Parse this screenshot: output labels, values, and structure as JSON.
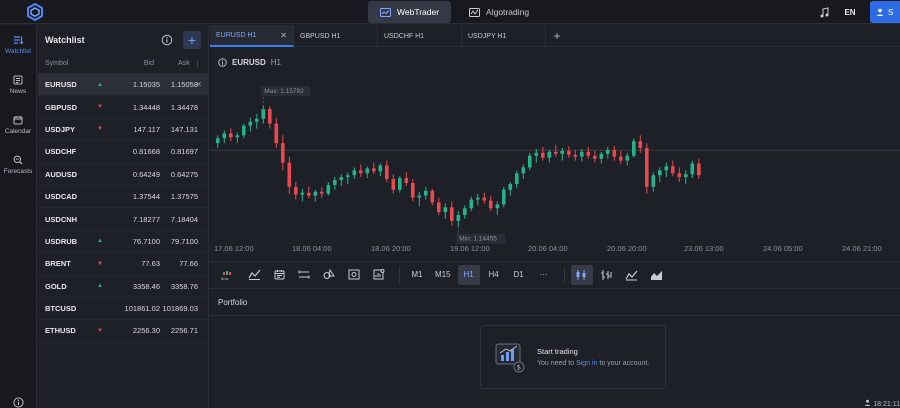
{
  "topbar": {
    "tabs": [
      {
        "label": "WebTrader",
        "active": true
      },
      {
        "label": "Algotrading",
        "active": false
      }
    ],
    "lang": "EN",
    "user_initial": "S"
  },
  "rail": [
    {
      "label": "Watchlist",
      "icon": "list-icon",
      "active": true
    },
    {
      "label": "News",
      "icon": "news-icon",
      "active": false
    },
    {
      "label": "Calendar",
      "icon": "calendar-icon",
      "active": false
    },
    {
      "label": "Forecasts",
      "icon": "forecast-icon",
      "active": false
    }
  ],
  "watchlist": {
    "title": "Watchlist",
    "columns": {
      "symbol": "Symbol",
      "bid": "Bid",
      "ask": "Ask"
    },
    "rows": [
      {
        "symbol": "EURUSD",
        "dir": "up",
        "bid": "1.15035",
        "ask": "1.15058",
        "selected": true
      },
      {
        "symbol": "GBPUSD",
        "dir": "down",
        "bid": "1.34448",
        "ask": "1.34478"
      },
      {
        "symbol": "USDJPY",
        "dir": "down",
        "bid": "147.117",
        "ask": "147.131"
      },
      {
        "symbol": "USDCHF",
        "dir": "",
        "bid": "0.81668",
        "ask": "0.81697"
      },
      {
        "symbol": "AUDUSD",
        "dir": "",
        "bid": "0.64249",
        "ask": "0.64275"
      },
      {
        "symbol": "USDCAD",
        "dir": "",
        "bid": "1.37544",
        "ask": "1.37575"
      },
      {
        "symbol": "USDCNH",
        "dir": "",
        "bid": "7.18277",
        "ask": "7.18404"
      },
      {
        "symbol": "USDRUB",
        "dir": "up",
        "bid": "76.7100",
        "ask": "79.7100"
      },
      {
        "symbol": "BRENT",
        "dir": "down",
        "bid": "77.63",
        "ask": "77.66"
      },
      {
        "symbol": "GOLD",
        "dir": "up",
        "bid": "3358.46",
        "ask": "3358.76"
      },
      {
        "symbol": "BTCUSD",
        "dir": "",
        "bid": "101861.02",
        "ask": "101869.03"
      },
      {
        "symbol": "ETHUSD",
        "dir": "down",
        "bid": "2256.30",
        "ask": "2256.71"
      }
    ]
  },
  "chart_tabs": [
    {
      "label": "EURUSD H1",
      "active": true
    },
    {
      "label": "GBPUSD H1",
      "active": false
    },
    {
      "label": "USDCHF H1",
      "active": false
    },
    {
      "label": "USDJPY H1",
      "active": false
    }
  ],
  "chart_header": {
    "symbol": "EURUSD",
    "timeframe": "H1"
  },
  "chart_labels": {
    "max": "Max: 1.15792",
    "min": "Min: 1.14455"
  },
  "xaxis": [
    "17.06 12:00",
    "18.06 04:00",
    "18.06 20:00",
    "19.06 12:00",
    "20.06 04:00",
    "20.06 20:00",
    "23.06 13:00",
    "24.06 05:00",
    "24.06 21:00"
  ],
  "timeframes": [
    {
      "label": "M1",
      "active": false
    },
    {
      "label": "M15",
      "active": false
    },
    {
      "label": "H1",
      "active": true
    },
    {
      "label": "H4",
      "active": false
    },
    {
      "label": "D1",
      "active": false
    },
    {
      "label": "···",
      "active": false
    }
  ],
  "portfolio": {
    "title": "Portfolio",
    "empty_title": "Start trading",
    "empty_pre": "You need to ",
    "empty_link": "Sign in",
    "empty_post": " to your account."
  },
  "colors": {
    "up": "#26b38c",
    "down": "#e84a4f",
    "accent": "#3d7bf0"
  },
  "clock": "18:21:11",
  "chart_data": {
    "type": "candlestick",
    "max": 1.15792,
    "min": 1.14455,
    "candles": [
      [
        1.154,
        1.1548,
        1.1535,
        1.1545
      ],
      [
        1.1545,
        1.1553,
        1.154,
        1.155
      ],
      [
        1.155,
        1.1555,
        1.1542,
        1.1546
      ],
      [
        1.1546,
        1.1551,
        1.154,
        1.1548
      ],
      [
        1.1548,
        1.156,
        1.1545,
        1.1558
      ],
      [
        1.1558,
        1.1566,
        1.1552,
        1.1562
      ],
      [
        1.1562,
        1.157,
        1.1555,
        1.1565
      ],
      [
        1.1565,
        1.1579,
        1.156,
        1.1575
      ],
      [
        1.1575,
        1.1578,
        1.1555,
        1.156
      ],
      [
        1.156,
        1.1566,
        1.1535,
        1.154
      ],
      [
        1.154,
        1.1548,
        1.1512,
        1.152
      ],
      [
        1.152,
        1.1526,
        1.1488,
        1.1495
      ],
      [
        1.1495,
        1.15,
        1.1482,
        1.1487
      ],
      [
        1.1487,
        1.1493,
        1.148,
        1.1489
      ],
      [
        1.1489,
        1.1495,
        1.1483,
        1.1486
      ],
      [
        1.1486,
        1.1492,
        1.148,
        1.149
      ],
      [
        1.149,
        1.1495,
        1.1484,
        1.1488
      ],
      [
        1.1488,
        1.15,
        1.1486,
        1.1497
      ],
      [
        1.1497,
        1.1505,
        1.1492,
        1.1502
      ],
      [
        1.1502,
        1.1508,
        1.1496,
        1.1505
      ],
      [
        1.1505,
        1.151,
        1.1498,
        1.1507
      ],
      [
        1.1507,
        1.1515,
        1.1503,
        1.1512
      ],
      [
        1.1512,
        1.1518,
        1.1505,
        1.1509
      ],
      [
        1.1509,
        1.1516,
        1.1504,
        1.1514
      ],
      [
        1.1514,
        1.152,
        1.1508,
        1.1511
      ],
      [
        1.1511,
        1.1519,
        1.1506,
        1.1517
      ],
      [
        1.1517,
        1.1522,
        1.15,
        1.1503
      ],
      [
        1.1503,
        1.1508,
        1.1488,
        1.1492
      ],
      [
        1.1492,
        1.1506,
        1.1489,
        1.1504
      ],
      [
        1.1504,
        1.151,
        1.1496,
        1.1499
      ],
      [
        1.1499,
        1.1503,
        1.148,
        1.1484
      ],
      [
        1.1484,
        1.149,
        1.1475,
        1.1486
      ],
      [
        1.1486,
        1.1495,
        1.1482,
        1.1491
      ],
      [
        1.1491,
        1.1493,
        1.1476,
        1.1479
      ],
      [
        1.1479,
        1.1484,
        1.1466,
        1.1469
      ],
      [
        1.1469,
        1.1478,
        1.1462,
        1.1474
      ],
      [
        1.1474,
        1.148,
        1.1455,
        1.146
      ],
      [
        1.146,
        1.147,
        1.1454,
        1.1466
      ],
      [
        1.1466,
        1.1476,
        1.1462,
        1.1473
      ],
      [
        1.1473,
        1.1485,
        1.147,
        1.1482
      ],
      [
        1.1482,
        1.1488,
        1.1476,
        1.1484
      ],
      [
        1.1484,
        1.1489,
        1.1478,
        1.1481
      ],
      [
        1.1481,
        1.1486,
        1.147,
        1.1473
      ],
      [
        1.1473,
        1.148,
        1.1466,
        1.1477
      ],
      [
        1.1477,
        1.1495,
        1.1474,
        1.1492
      ],
      [
        1.1492,
        1.15,
        1.1486,
        1.1498
      ],
      [
        1.1498,
        1.1512,
        1.1494,
        1.1509
      ],
      [
        1.1509,
        1.1518,
        1.1503,
        1.1515
      ],
      [
        1.1515,
        1.153,
        1.1512,
        1.1527
      ],
      [
        1.1527,
        1.1534,
        1.152,
        1.153
      ],
      [
        1.153,
        1.1536,
        1.1522,
        1.1525
      ],
      [
        1.1525,
        1.1533,
        1.152,
        1.1531
      ],
      [
        1.1531,
        1.1538,
        1.1526,
        1.1529
      ],
      [
        1.1529,
        1.1535,
        1.1522,
        1.1532
      ],
      [
        1.1532,
        1.1537,
        1.1525,
        1.1528
      ],
      [
        1.1528,
        1.1533,
        1.1522,
        1.1526
      ],
      [
        1.1526,
        1.1534,
        1.1521,
        1.1531
      ],
      [
        1.1531,
        1.1536,
        1.1524,
        1.1527
      ],
      [
        1.1527,
        1.1532,
        1.152,
        1.1524
      ],
      [
        1.1524,
        1.1531,
        1.1519,
        1.1529
      ],
      [
        1.1529,
        1.1536,
        1.1524,
        1.1533
      ],
      [
        1.1533,
        1.1537,
        1.1522,
        1.1526
      ],
      [
        1.1526,
        1.1532,
        1.1518,
        1.1522
      ],
      [
        1.1522,
        1.153,
        1.1517,
        1.1527
      ],
      [
        1.1527,
        1.1545,
        1.1525,
        1.1542
      ],
      [
        1.1542,
        1.1548,
        1.153,
        1.1535
      ],
      [
        1.1535,
        1.154,
        1.1488,
        1.1495
      ],
      [
        1.1495,
        1.151,
        1.149,
        1.1507
      ],
      [
        1.1507,
        1.1515,
        1.15,
        1.1512
      ],
      [
        1.1512,
        1.152,
        1.1505,
        1.1516
      ],
      [
        1.1516,
        1.1522,
        1.1506,
        1.1509
      ],
      [
        1.1509,
        1.1515,
        1.15,
        1.1505
      ],
      [
        1.1505,
        1.1512,
        1.1498,
        1.1508
      ],
      [
        1.1508,
        1.1522,
        1.1504,
        1.1519
      ],
      [
        1.1519,
        1.1524,
        1.1503,
        1.1507
      ]
    ]
  }
}
